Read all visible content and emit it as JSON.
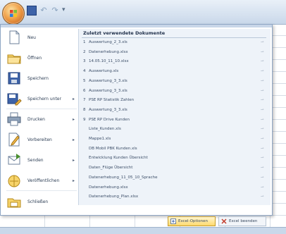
{
  "quick_access": {
    "icons": [
      "save-icon",
      "undo-icon",
      "redo-icon",
      "customize-icon"
    ],
    "undo_glyph": "↶",
    "redo_glyph": "↷",
    "more_glyph": "▾"
  },
  "menu": {
    "left_items": [
      {
        "label": "Neu",
        "icon": "new-document-icon",
        "arrow": ""
      },
      {
        "label": "Öffnen",
        "icon": "open-folder-icon",
        "arrow": ""
      },
      {
        "label": "Speichern",
        "icon": "save-icon",
        "arrow": ""
      },
      {
        "label": "Speichern unter",
        "icon": "save-as-icon",
        "arrow": "▸"
      },
      {
        "label": "Drucken",
        "icon": "print-icon",
        "arrow": "▸"
      },
      {
        "label": "Vorbereiten",
        "icon": "prepare-icon",
        "arrow": "▸"
      },
      {
        "label": "Senden",
        "icon": "send-icon",
        "arrow": "▸"
      },
      {
        "label": "Veröffentlichen",
        "icon": "publish-icon",
        "arrow": "▸"
      },
      {
        "label": "Schließen",
        "icon": "close-folder-icon",
        "arrow": ""
      }
    ],
    "recent_title": "Zuletzt verwendete Dokumente",
    "recent_docs": [
      {
        "num": "1",
        "name": "Auswertung_2_3.xls"
      },
      {
        "num": "2",
        "name": "Datenerhebung.xlsx"
      },
      {
        "num": "3",
        "name": "14.05.10_11_10.xlsx"
      },
      {
        "num": "4",
        "name": "Auswertung.xls"
      },
      {
        "num": "5",
        "name": "Auswertung_3_3.xls"
      },
      {
        "num": "6",
        "name": "Auswertung_3_3.xls"
      },
      {
        "num": "7",
        "name": "PSE RP Statistik Zahlen"
      },
      {
        "num": "8",
        "name": "Auswertung_3_3.xls"
      },
      {
        "num": "9",
        "name": "PSE RP Drive Kunden"
      },
      {
        "num": "",
        "name": "Liste_Kunden.xls"
      },
      {
        "num": "",
        "name": "Mappe1.xls"
      },
      {
        "num": "",
        "name": "DB Mobil PBK Kunden.xls"
      },
      {
        "num": "",
        "name": "Entwicklung Kunden Übersicht"
      },
      {
        "num": "",
        "name": "Daten_Flüge Übersicht"
      },
      {
        "num": "",
        "name": "Datenerhebung_11_05_10_Sprache"
      },
      {
        "num": "",
        "name": "Datenerhebung.xlsx"
      },
      {
        "num": "",
        "name": "Datenerhebung_Plan.xlsx"
      }
    ],
    "pin_glyph": "⊸",
    "options_label": "Excel-Optionen",
    "exit_label": "Excel beenden"
  },
  "colors": {
    "office_orange": "#f0a04a",
    "menu_border": "#8ea6c4",
    "recent_bg": "#eef3f9",
    "options_gold": "#ffd96e"
  }
}
